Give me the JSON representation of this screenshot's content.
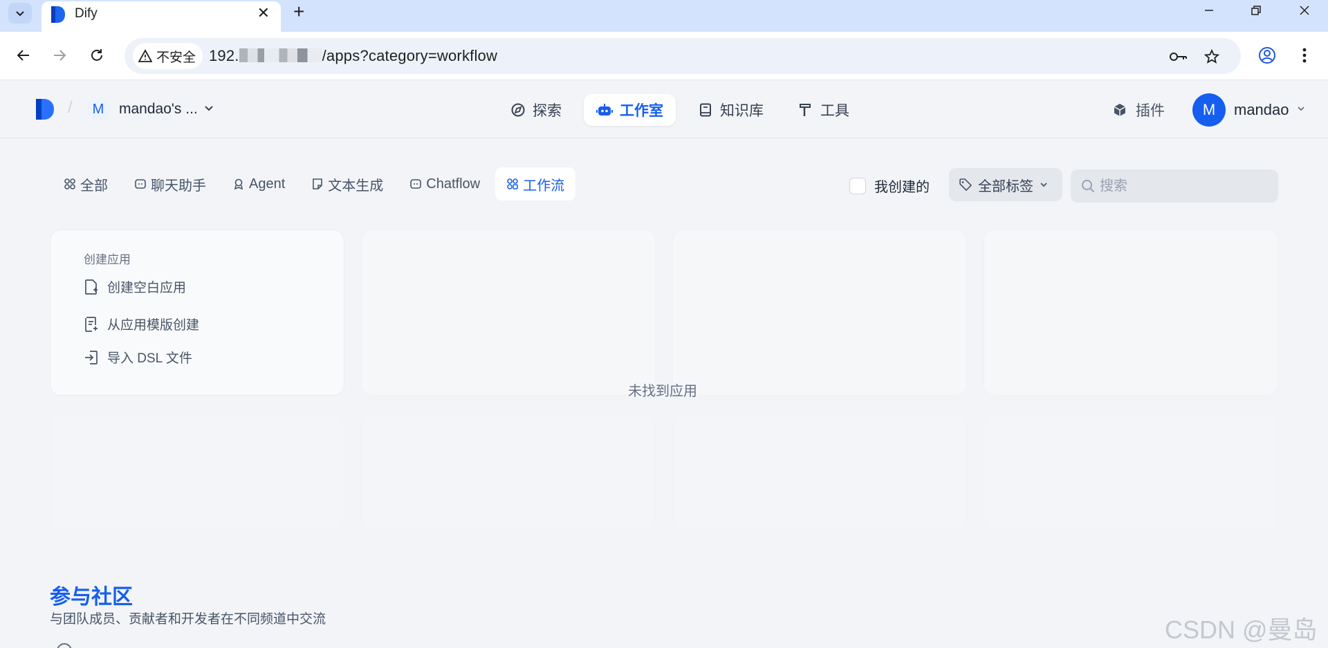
{
  "browser": {
    "tab_title": "Dify",
    "security_label": "不安全",
    "url_prefix": "192.",
    "url_suffix": "/apps?category=workflow"
  },
  "header": {
    "workspace_initial": "M",
    "workspace_name": "mandao's ...",
    "nav": [
      {
        "label": "探索",
        "icon": "compass-icon"
      },
      {
        "label": "工作室",
        "icon": "robot-icon",
        "active": true
      },
      {
        "label": "知识库",
        "icon": "book-icon"
      },
      {
        "label": "工具",
        "icon": "hammer-icon"
      }
    ],
    "plugins_label": "插件",
    "user_initial": "M",
    "user_name": "mandao"
  },
  "filters": {
    "tabs": [
      {
        "label": "全部",
        "icon": "grid-icon"
      },
      {
        "label": "聊天助手",
        "icon": "chat-icon"
      },
      {
        "label": "Agent",
        "icon": "agent-icon"
      },
      {
        "label": "文本生成",
        "icon": "note-icon"
      },
      {
        "label": "Chatflow",
        "icon": "chatflow-icon"
      },
      {
        "label": "工作流",
        "icon": "workflow-icon",
        "active": true
      }
    ],
    "mine_label": "我创建的",
    "tags_label": "全部标签",
    "search_placeholder": "搜索"
  },
  "create_card": {
    "title": "创建应用",
    "items": [
      "创建空白应用",
      "从应用模版创建",
      "导入 DSL 文件"
    ]
  },
  "empty_text": "未找到应用",
  "community": {
    "title": "参与社区",
    "subtitle": "与团队成员、贡献者和开发者在不同频道中交流"
  },
  "watermark": "CSDN @曼岛_",
  "colors": {
    "accent": "#155eef",
    "background": "#f2f4f7"
  }
}
